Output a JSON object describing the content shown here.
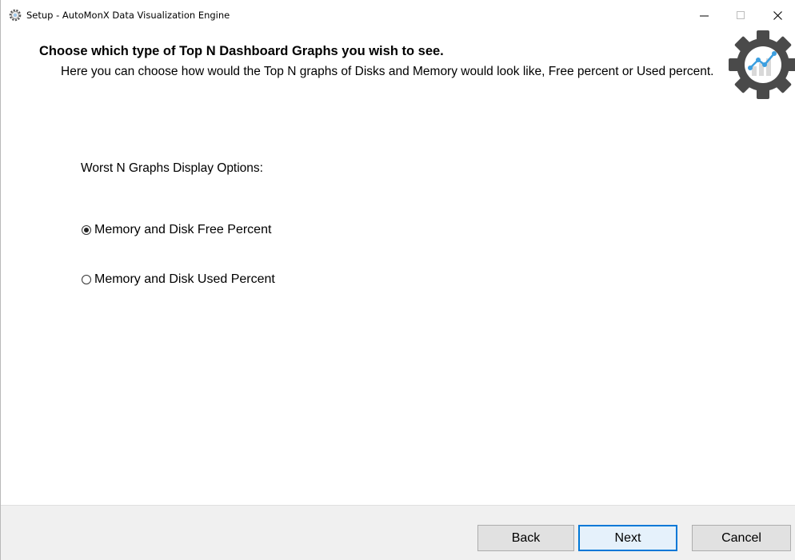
{
  "window": {
    "title": "Setup - AutoMonX Data Visualization Engine",
    "controls": {
      "minimize": "—",
      "maximize": "☐",
      "close": "✕"
    }
  },
  "header": {
    "title": "Choose which type of Top N Dashboard Graphs you wish to see.",
    "description": "Here you can choose how would the Top N graphs of Disks and Memory would look like, Free percent or Used percent.",
    "logo_icon": "gear-chart-icon"
  },
  "options": {
    "label": "Worst N Graphs Display Options:",
    "items": [
      {
        "label": "Memory and Disk Free Percent",
        "checked": true
      },
      {
        "label": "Memory and Disk Used Percent",
        "checked": false
      }
    ]
  },
  "footer": {
    "back_label": "Back",
    "next_label": "Next",
    "cancel_label": "Cancel"
  },
  "colors": {
    "accent": "#0078d7",
    "logo_gear": "#4a4a4a",
    "logo_chart": "#3c9fe0"
  }
}
